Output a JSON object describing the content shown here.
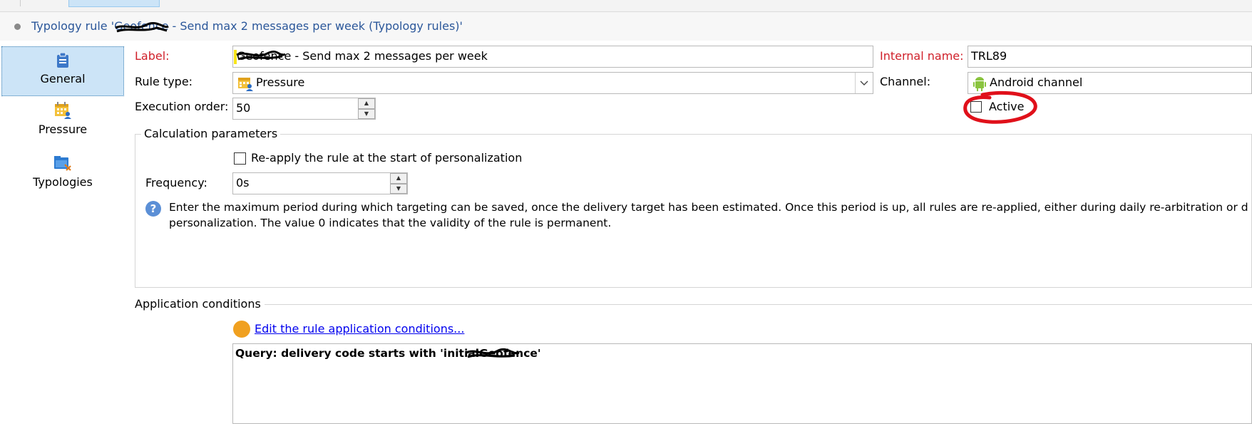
{
  "window": {
    "title": "Typology rule 'Geofence - Send max 2 messages per week (Typology rules)'"
  },
  "nav": {
    "items": [
      {
        "label": "General",
        "icon": "clipboard-icon",
        "selected": true
      },
      {
        "label": "Pressure",
        "icon": "calendar-person-icon",
        "selected": false
      },
      {
        "label": "Typologies",
        "icon": "folder-typology-icon",
        "selected": false
      }
    ]
  },
  "form": {
    "label_caption": "Label:",
    "label_value": "Geofence - Send max 2 messages per week",
    "internal_name_caption": "Internal name:",
    "internal_name_value": "TRL89",
    "rule_type_caption": "Rule type:",
    "rule_type_value": "Pressure",
    "channel_caption": "Channel:",
    "channel_value": "Android channel",
    "execution_order_caption": "Execution order:",
    "execution_order_value": "50",
    "active_label": "Active",
    "active_checked": false
  },
  "calculation": {
    "legend": "Calculation parameters",
    "reapply_label": "Re-apply the rule at the start of personalization",
    "reapply_checked": false,
    "frequency_caption": "Frequency:",
    "frequency_value": "0s",
    "help_line1": "Enter the maximum period during which targeting can be saved, once the delivery target has been estimated. Once this period is up, all rules are re-applied, either during daily re-arbitration or d",
    "help_line2": "personalization. The value 0 indicates that the validity of the rule is permanent."
  },
  "conditions": {
    "legend": "Application conditions",
    "edit_link": "Edit the rule application conditions...",
    "query": "Query: delivery code starts with 'initialGeofence'"
  },
  "colors": {
    "accent": "#2b579a",
    "required_label": "#d0202a",
    "selection": "#cce4f7",
    "annotation": "#e0101a",
    "edit_dot": "#f0a020"
  }
}
